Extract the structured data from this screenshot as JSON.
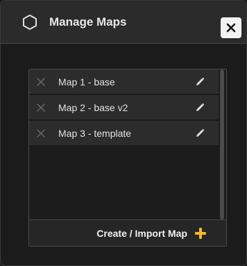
{
  "dialog": {
    "title": "Manage Maps",
    "icon": "hexagon-icon",
    "close_icon": "close-icon"
  },
  "maps": [
    {
      "name": "Map 1 - base"
    },
    {
      "name": "Map 2 - base v2"
    },
    {
      "name": "Map 3 - template"
    }
  ],
  "row_icons": {
    "remove": "close-x-icon",
    "edit": "pencil-icon"
  },
  "footer": {
    "create_label": "Create / Import Map",
    "plus_icon": "plus-icon",
    "plus_color": "#f5b82e"
  }
}
